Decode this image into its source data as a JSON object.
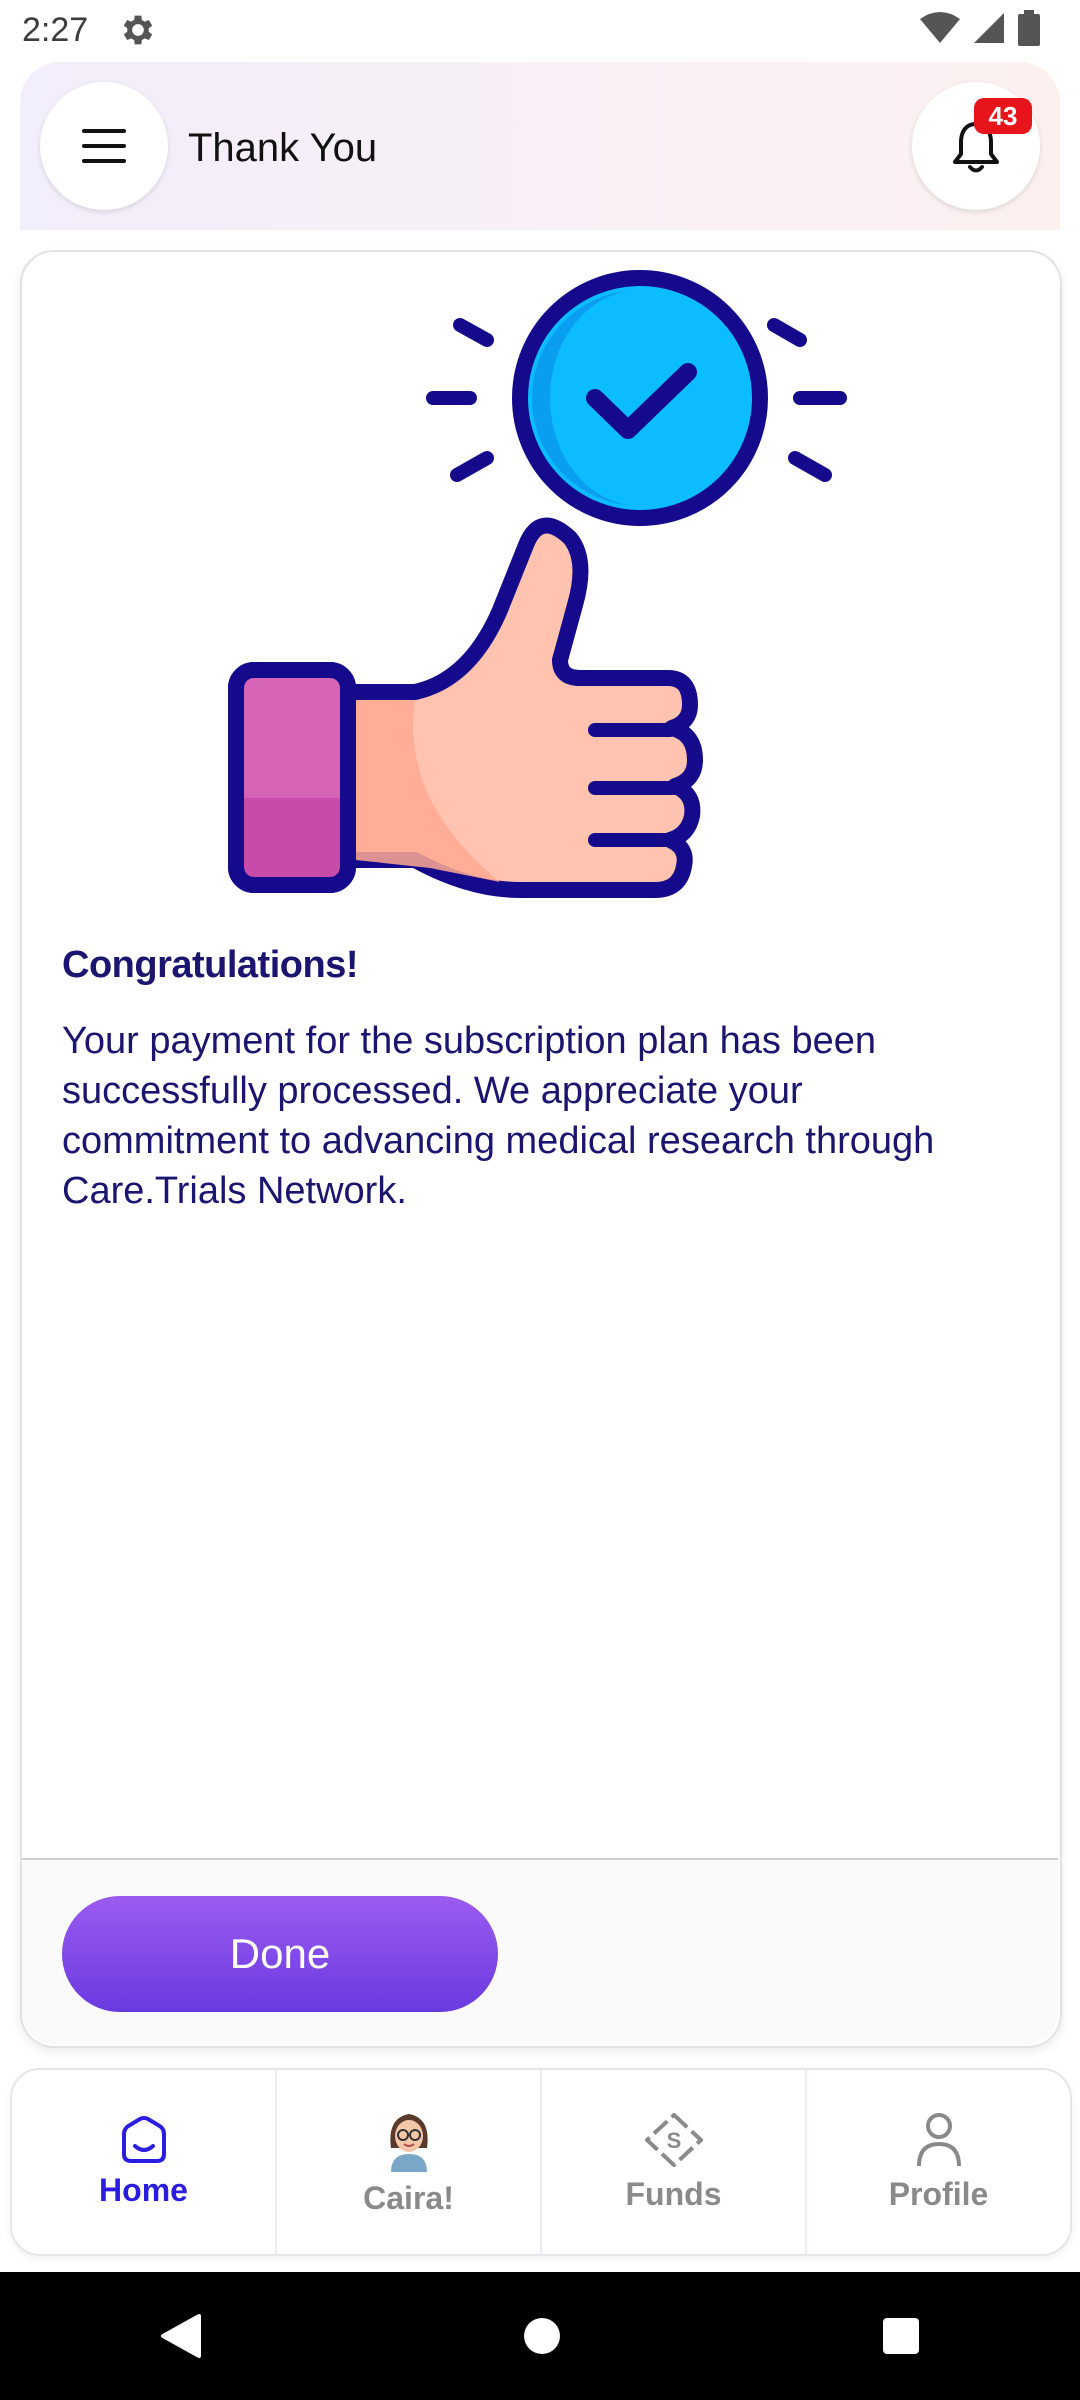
{
  "status_bar": {
    "time": "2:27"
  },
  "header": {
    "title": "Thank You",
    "notification_count": "43"
  },
  "card": {
    "heading": "Congratulations!",
    "message": "Your payment for the subscription plan has been successfully processed. We appreciate your commitment to advancing medical research through Care.Trials Network.",
    "done_label": "Done"
  },
  "bottom_nav": {
    "items": [
      {
        "label": "Home",
        "icon": "home-icon",
        "active": true
      },
      {
        "label": "Caira!",
        "icon": "caira-avatar",
        "active": false
      },
      {
        "label": "Funds",
        "icon": "funds-icon",
        "active": false
      },
      {
        "label": "Profile",
        "icon": "profile-icon",
        "active": false
      }
    ]
  },
  "colors": {
    "primary_text": "#1b1570",
    "accent_active": "#2a1de0",
    "button_top": "#9b5bf0",
    "button_bottom": "#6a3ae0",
    "badge": "#e7151b"
  }
}
